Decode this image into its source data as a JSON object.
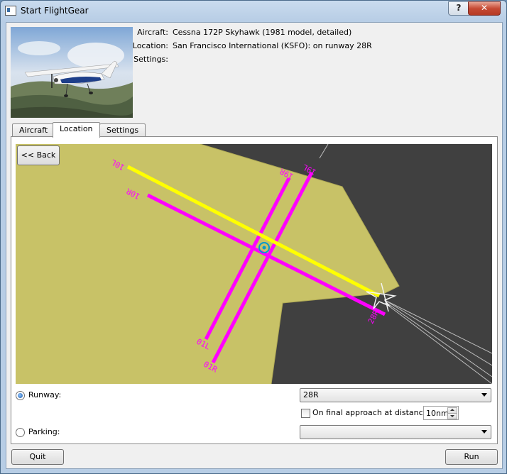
{
  "window": {
    "title": "Start FlightGear",
    "help_label": "?",
    "close_label": "✕"
  },
  "info": {
    "aircraft_label": "Aircraft:",
    "aircraft_value": "Cessna 172P Skyhawk (1981 model, detailed)",
    "location_label": "Location:",
    "location_value": "San Francisco International (KSFO): on runway 28R",
    "settings_label": "Settings:"
  },
  "tabs": [
    {
      "label": "Aircraft",
      "active": false
    },
    {
      "label": "Location",
      "active": true
    },
    {
      "label": "Settings",
      "active": false
    }
  ],
  "map": {
    "back_label": "<< Back",
    "runway_labels": [
      "10L",
      "10R",
      "19R",
      "19L",
      "01L",
      "01R",
      "28R"
    ],
    "colors": {
      "land": "#c8c267",
      "dark": "#404040",
      "runway": "#ff00ff",
      "selected_runway": "#ffff00",
      "marker": "#0099cc"
    }
  },
  "runway_option": {
    "label": "Runway:",
    "selected": true,
    "value": "28R"
  },
  "final_approach": {
    "label": "On final approach at distance:",
    "checked": false,
    "distance": "10nm"
  },
  "parking_option": {
    "label": "Parking:",
    "selected": false,
    "value": ""
  },
  "footer": {
    "quit_label": "Quit",
    "run_label": "Run"
  }
}
